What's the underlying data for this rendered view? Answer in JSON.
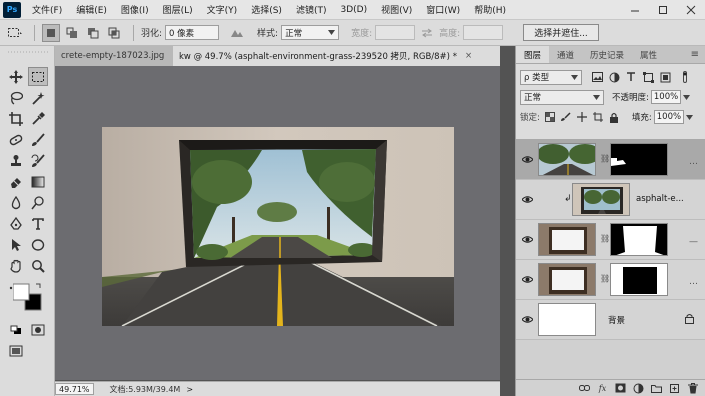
{
  "app": {
    "logo": "Ps",
    "menus": [
      "文件(F)",
      "编辑(E)",
      "图像(I)",
      "图层(L)",
      "文字(Y)",
      "选择(S)",
      "滤镜(T)",
      "3D(D)",
      "视图(V)",
      "窗口(W)",
      "帮助(H)"
    ]
  },
  "options": {
    "feather_label": "羽化:",
    "feather_value": "0 像素",
    "style_label": "样式:",
    "style_value": "正常",
    "width_label": "宽度:",
    "height_label": "高度:",
    "select_mask_button": "选择并遮住..."
  },
  "tabs": [
    {
      "label": "crete-empty-187023.jpg",
      "close": "×"
    },
    {
      "label": "kw @ 49.7% (asphalt-environment-grass-239520 拷贝, RGB/8#) *",
      "close": "×"
    }
  ],
  "status": {
    "zoom": "49.71%",
    "doc_size": "文档:5.93M/39.4M",
    "arrow": ">"
  },
  "layers_panel": {
    "tabs": [
      "图层",
      "通道",
      "历史记录",
      "属性"
    ],
    "filter_kind": "ρ 类型",
    "blend_mode": "正常",
    "opacity_label": "不透明度:",
    "opacity_value": "100%",
    "lock_label": "锁定:",
    "fill_label": "填充:",
    "fill_value": "100%",
    "layers": [
      {
        "name": "",
        "selected": true,
        "has_mask": true,
        "clipped": false
      },
      {
        "name": "asphalt-e...",
        "selected": false,
        "has_mask": false,
        "clipped": true
      },
      {
        "name": "",
        "selected": false,
        "has_mask": true,
        "clipped": false
      },
      {
        "name": "",
        "selected": false,
        "has_mask": true,
        "clipped": false
      },
      {
        "name": "背景",
        "selected": false,
        "has_mask": false,
        "clipped": false,
        "locked": true
      }
    ],
    "footer_icons": [
      "link-icon",
      "fx-icon",
      "mask-icon",
      "adjustment-icon",
      "folder-icon",
      "new-layer-icon",
      "trash-icon"
    ],
    "footer_fx": "fx"
  },
  "colors": {
    "accent": "#31a8ff",
    "canvas_bg": "#6c6c70",
    "panel_bg": "#dcdcdc"
  }
}
